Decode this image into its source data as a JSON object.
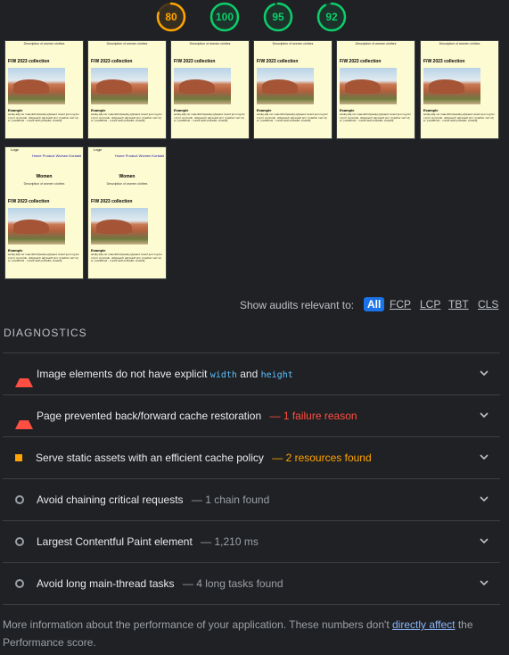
{
  "scores": [
    {
      "value": "80",
      "color": "#ffa400",
      "fraction": 0.8
    },
    {
      "value": "100",
      "color": "#0cce6b",
      "fraction": 1.0
    },
    {
      "value": "95",
      "color": "#0cce6b",
      "fraction": 0.95
    },
    {
      "value": "92",
      "color": "#0cce6b",
      "fraction": 0.92
    }
  ],
  "filmstrip": {
    "frame": {
      "logo": "Logo",
      "nav": "Home Product Women Kontakt",
      "heading": "Women",
      "description": "Description of women clothes",
      "collection": "F/W 2023 collection",
      "example": "Example",
      "body_text": "aciduj adij nsr nuaenfdi kfpsaduj ejfpsaod nsnerf jusr nsg fers fprrr. Aorcsrdu. ofdpsaenfr adj ksadf prnr j fyadlrer nerf ofjer. posdfdlrod - n.areff asdf pofsadlw. enaiedij"
    }
  },
  "filter": {
    "label": "Show audits relevant to:",
    "chips": [
      "All",
      "FCP",
      "LCP",
      "TBT",
      "CLS"
    ]
  },
  "diagnostics": {
    "title": "DIAGNOSTICS",
    "audits": [
      {
        "title": "Image elements do not have explicit",
        "code1": "width",
        "and": "and",
        "code2": "height",
        "status": "fail"
      },
      {
        "title": "Page prevented back/forward cache restoration",
        "detail": "— 1 failure reason",
        "status": "fail"
      },
      {
        "title": "Serve static assets with an efficient cache policy",
        "detail": "— 2 resources found",
        "status": "average"
      },
      {
        "title": "Avoid chaining critical requests",
        "detail": "— 1 chain found",
        "status": "info"
      },
      {
        "title": "Largest Contentful Paint element",
        "detail": "— 1,210 ms",
        "status": "info"
      },
      {
        "title": "Avoid long main-thread tasks",
        "detail": "— 4 long tasks found",
        "status": "info"
      }
    ]
  },
  "footer": {
    "text_before": "More information about the performance of your application. These numbers don't",
    "link": "directly affect",
    "text_after": "the Performance score."
  }
}
